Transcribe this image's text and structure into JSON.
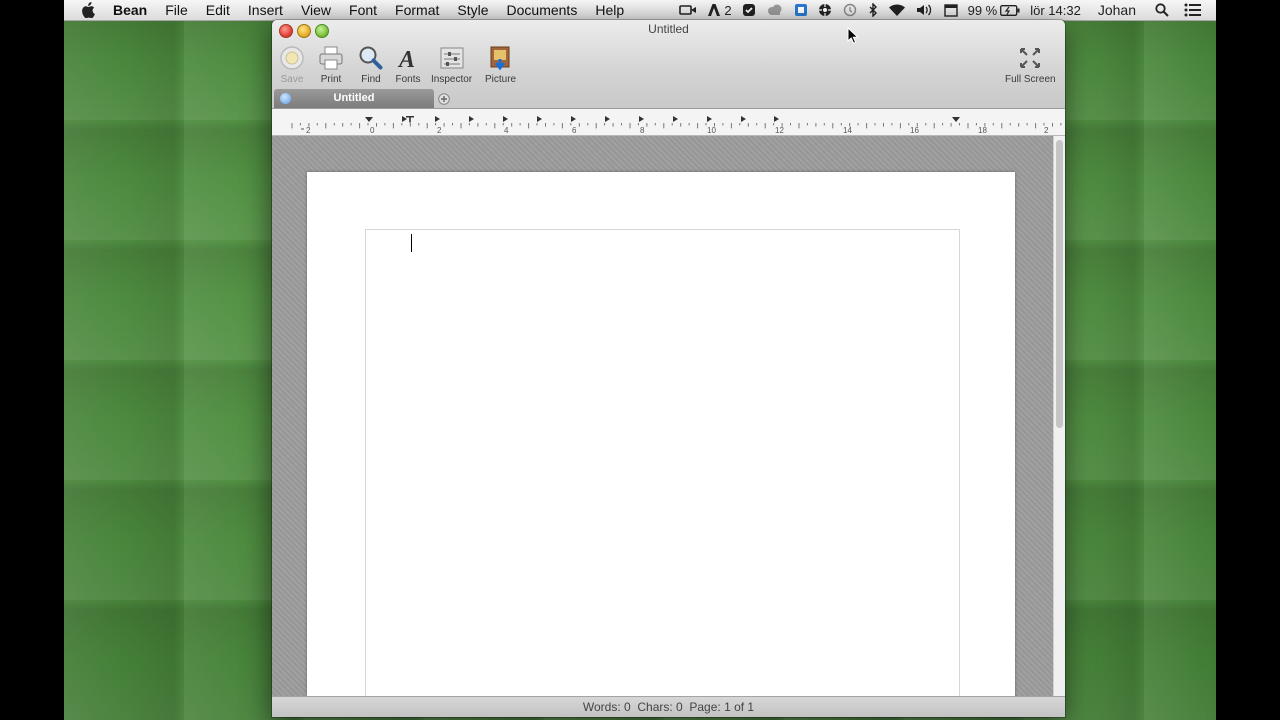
{
  "menubar": {
    "app_name": "Bean",
    "items": [
      "File",
      "Edit",
      "Insert",
      "View",
      "Font",
      "Format",
      "Style",
      "Documents",
      "Help"
    ],
    "status": {
      "notification_count": "2",
      "battery": "99 %",
      "clock": "lör 14:32",
      "user": "Johan"
    }
  },
  "window": {
    "title": "Untitled",
    "toolbar": {
      "save": "Save",
      "print": "Print",
      "find": "Find",
      "fonts": "Fonts",
      "inspector": "Inspector",
      "picture": "Picture",
      "full_screen": "Full Screen"
    },
    "tab": {
      "label": "Untitled"
    },
    "ruler": {
      "labels": [
        "2",
        "0",
        "2",
        "4",
        "6",
        "8",
        "10",
        "12",
        "14",
        "16",
        "18",
        "2"
      ]
    },
    "status_text": "Words: 0  Chars: 0  Page: 1 of 1"
  },
  "colors": {
    "desktop": "#4c8a3e",
    "close": "#e0443a",
    "minimize": "#e9b02a",
    "zoom": "#7ec43e",
    "tab": "#8a8a8a"
  }
}
